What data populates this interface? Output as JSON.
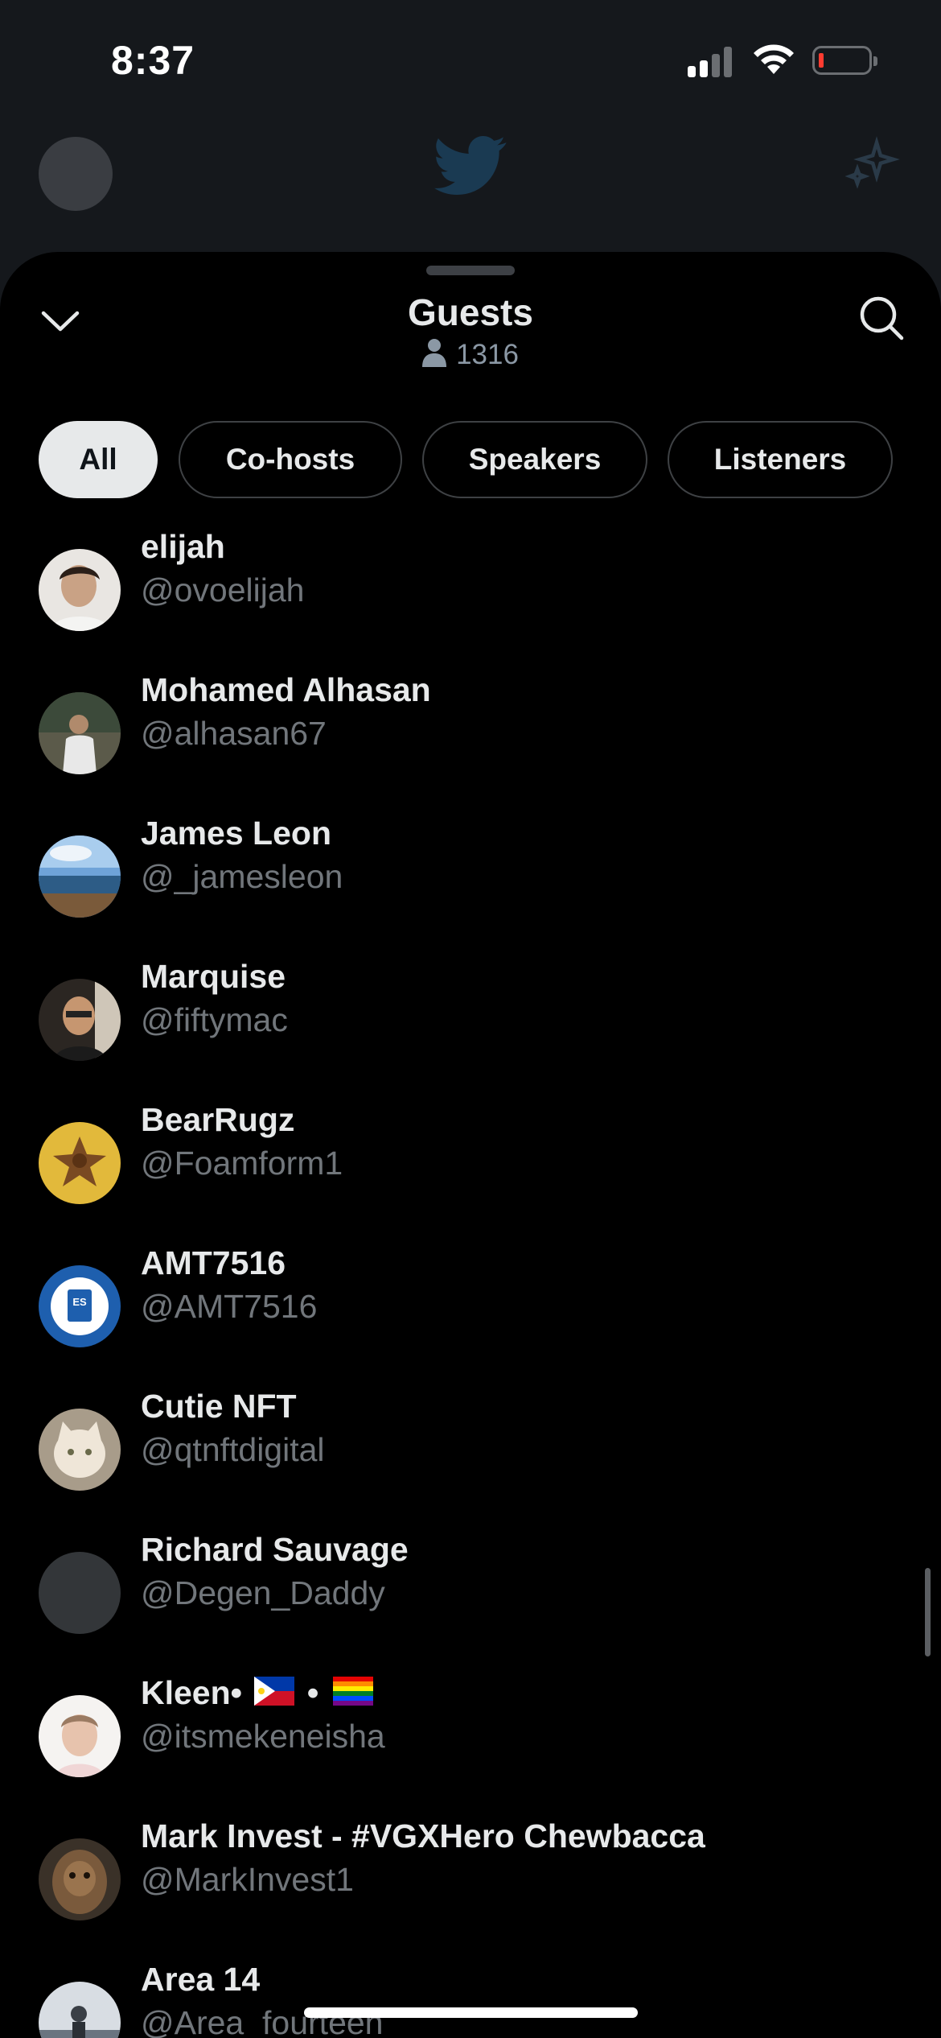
{
  "status_bar": {
    "time": "8:37"
  },
  "sheet": {
    "title": "Guests",
    "guest_count": "1316"
  },
  "filters": [
    {
      "label": "All",
      "active": true
    },
    {
      "label": "Co-hosts",
      "active": false
    },
    {
      "label": "Speakers",
      "active": false
    },
    {
      "label": "Listeners",
      "active": false
    }
  ],
  "guests": [
    {
      "name": "elijah",
      "handle": "@ovoelijah"
    },
    {
      "name": "Mohamed Alhasan",
      "handle": "@alhasan67"
    },
    {
      "name": "James Leon",
      "handle": "@_jamesleon"
    },
    {
      "name": "Marquise",
      "handle": "@fiftymac"
    },
    {
      "name": "BearRugz",
      "handle": "@Foamform1"
    },
    {
      "name": "AMT7516",
      "handle": "@AMT7516"
    },
    {
      "name": "Cutie NFT",
      "handle": "@qtnftdigital"
    },
    {
      "name": "Richard Sauvage",
      "handle": "@Degen_Daddy"
    },
    {
      "name": "Kleen•",
      "name_suffix": "•",
      "handle": "@itsmekeneisha"
    },
    {
      "name": "Mark Invest - #VGXHero Chewbacca",
      "handle": "@MarkInvest1"
    },
    {
      "name": "Area 14",
      "handle": "@Area_fourteen"
    }
  ],
  "colors": {
    "background": "#000000",
    "text_primary": "#e7e9ea",
    "text_secondary": "#71767b",
    "twitter_blue": "#1d9bf0",
    "battery_low": "#ff3b30"
  },
  "icons": {
    "collapse": "chevron-down-icon",
    "search": "search-icon",
    "guest_count": "person-icon",
    "bg_logo": "twitter-bird-icon",
    "bg_sparkle": "sparkle-icon"
  }
}
